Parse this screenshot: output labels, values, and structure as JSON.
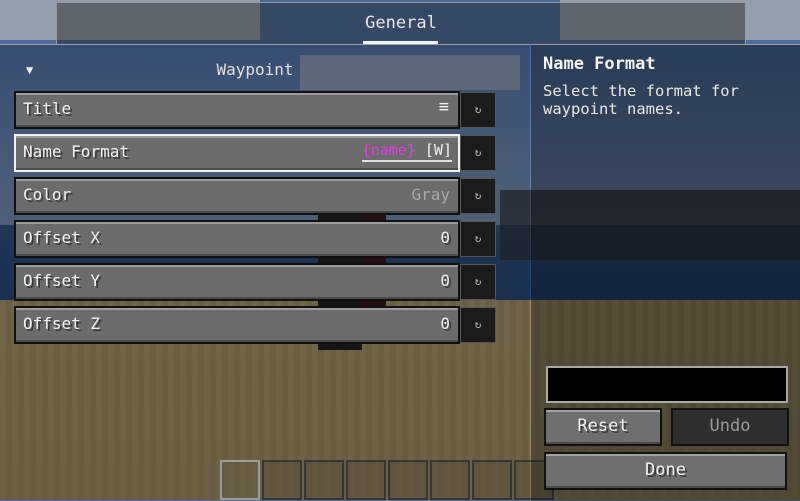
{
  "tabs": [
    {
      "label": "General",
      "selected": true
    }
  ],
  "group": {
    "title": "Waypoint",
    "expanded_icon": "triangle-down-icon"
  },
  "options": [
    {
      "label": "Title",
      "type": "menu",
      "icon": "menu-icon"
    },
    {
      "label": "Name Format",
      "type": "text",
      "focused": true,
      "value_placeholder": "{name}",
      "value_rest": " [W]"
    },
    {
      "label": "Color",
      "type": "cycle",
      "value": "Gray"
    },
    {
      "label": "Offset X",
      "type": "number",
      "value": "0"
    },
    {
      "label": "Offset Y",
      "type": "number",
      "value": "0"
    },
    {
      "label": "Offset Z",
      "type": "number",
      "value": "0"
    }
  ],
  "reset_icon": "reset-arrow-icon",
  "info": {
    "title": "Name Format",
    "description": "Select the format for waypoint names."
  },
  "edit_box": {
    "value": ""
  },
  "buttons": {
    "reset": "Reset",
    "undo": "Undo",
    "done": "Done"
  },
  "colors": {
    "placeholder_magenta": "#e040e0",
    "focused_border": "#f0f0f0"
  },
  "hotbar": {
    "slots": 9,
    "selected": 0
  }
}
